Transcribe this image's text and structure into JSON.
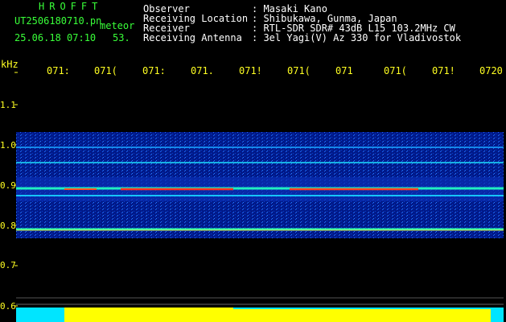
{
  "header": {
    "brand": "HROFFT",
    "filename": "UT2506180710.pn",
    "type": "meteor",
    "datetime": "25.06.18 07:10",
    "count": "53.",
    "rows": [
      {
        "label": "Observer",
        "value": ": Masaki Kano"
      },
      {
        "label": "Receiving Location",
        "value": ": Shibukawa, Gunma, Japan"
      },
      {
        "label": "Receiver",
        "value": ": RTL-SDR SDR# 43dB L15 103.2MHz CW"
      },
      {
        "label": "Receiving Antenna",
        "value": ": 3el Yagi(V) Az 330 for Vladivostok"
      }
    ]
  },
  "axis": {
    "unit": "kHz",
    "freq_labels": [
      "1.1",
      "1.0",
      "0.9",
      "0.8",
      "0.7",
      "0.6"
    ],
    "time_labels": [
      "071:",
      "071(",
      "071:",
      "071.",
      "071!",
      "071(",
      "071",
      "071(",
      "071!",
      "0720"
    ]
  },
  "colors": {
    "header_green": "#39ff39",
    "header_white": "#ffffff",
    "axis_yellow": "#ffff22",
    "bar_yellow": "#ffff00",
    "bar_cyan": "#00e5ff"
  }
}
